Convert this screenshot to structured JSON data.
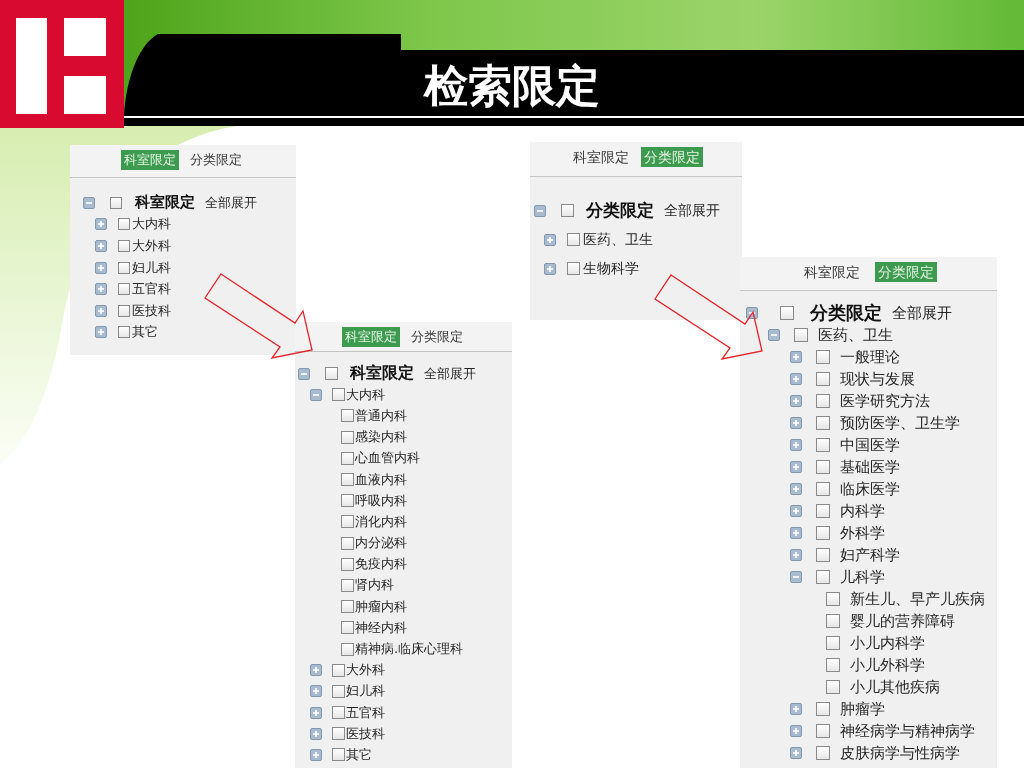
{
  "header": {
    "title": "检索限定"
  },
  "panels": [
    {
      "tabs": [
        {
          "label": "科室限定",
          "selected": true
        },
        {
          "label": "分类限定",
          "selected": false
        }
      ],
      "tree": {
        "label": "科室限定",
        "checked": false,
        "expanded": true,
        "action": "全部展开",
        "children": [
          {
            "label": "大内科",
            "checked": false,
            "expanded": false
          },
          {
            "label": "大外科",
            "checked": false,
            "expanded": false
          },
          {
            "label": "妇儿科",
            "checked": false,
            "expanded": false
          },
          {
            "label": "五官科",
            "checked": false,
            "expanded": false
          },
          {
            "label": "医技科",
            "checked": false,
            "expanded": false
          },
          {
            "label": "其它",
            "checked": false,
            "expanded": false
          }
        ]
      }
    },
    {
      "tabs": [
        {
          "label": "科室限定",
          "selected": true
        },
        {
          "label": "分类限定",
          "selected": false
        }
      ],
      "tree": {
        "label": "科室限定",
        "checked": false,
        "expanded": true,
        "action": "全部展开",
        "children": [
          {
            "label": "大内科",
            "checked": false,
            "expanded": true,
            "children": [
              {
                "label": "普通内科",
                "checked": false
              },
              {
                "label": "感染内科",
                "checked": false
              },
              {
                "label": "心血管内科",
                "checked": false
              },
              {
                "label": "血液内科",
                "checked": false
              },
              {
                "label": "呼吸内科",
                "checked": false
              },
              {
                "label": "消化内科",
                "checked": false
              },
              {
                "label": "内分泌科",
                "checked": false
              },
              {
                "label": "免疫内科",
                "checked": false
              },
              {
                "label": "肾内科",
                "checked": false
              },
              {
                "label": "肿瘤内科",
                "checked": false
              },
              {
                "label": "神经内科",
                "checked": false
              },
              {
                "label": "精神病.临床心理科",
                "checked": false
              }
            ]
          },
          {
            "label": "大外科",
            "checked": false,
            "expanded": false
          },
          {
            "label": "妇儿科",
            "checked": false,
            "expanded": false
          },
          {
            "label": "五官科",
            "checked": false,
            "expanded": false
          },
          {
            "label": "医技科",
            "checked": false,
            "expanded": false
          },
          {
            "label": "其它",
            "checked": false,
            "expanded": false
          }
        ]
      }
    },
    {
      "tabs": [
        {
          "label": "科室限定",
          "selected": false
        },
        {
          "label": "分类限定",
          "selected": true
        }
      ],
      "tree": {
        "label": "分类限定",
        "checked": false,
        "expanded": true,
        "action": "全部展开",
        "children": [
          {
            "label": "医药、卫生",
            "checked": false,
            "expanded": false
          },
          {
            "label": "生物科学",
            "checked": false,
            "expanded": false
          }
        ]
      }
    },
    {
      "tabs": [
        {
          "label": "科室限定",
          "selected": false
        },
        {
          "label": "分类限定",
          "selected": true
        }
      ],
      "tree": {
        "label": "分类限定",
        "checked": false,
        "expanded": true,
        "action": "全部展开",
        "children": [
          {
            "label": "医药、卫生",
            "checked": false,
            "expanded": true,
            "children": [
              {
                "label": "一般理论",
                "checked": false,
                "expanded": false
              },
              {
                "label": "现状与发展",
                "checked": false,
                "expanded": false
              },
              {
                "label": "医学研究方法",
                "checked": false,
                "expanded": false
              },
              {
                "label": "预防医学、卫生学",
                "checked": false,
                "expanded": false
              },
              {
                "label": "中国医学",
                "checked": false,
                "expanded": false
              },
              {
                "label": "基础医学",
                "checked": false,
                "expanded": false
              },
              {
                "label": "临床医学",
                "checked": false,
                "expanded": false
              },
              {
                "label": "内科学",
                "checked": false,
                "expanded": false
              },
              {
                "label": "外科学",
                "checked": false,
                "expanded": false
              },
              {
                "label": "妇产科学",
                "checked": false,
                "expanded": false
              },
              {
                "label": "儿科学",
                "checked": false,
                "expanded": true,
                "children": [
                  {
                    "label": "新生儿、早产儿疾病",
                    "checked": false
                  },
                  {
                    "label": "婴儿的营养障碍",
                    "checked": false
                  },
                  {
                    "label": "小儿内科学",
                    "checked": false
                  },
                  {
                    "label": "小儿外科学",
                    "checked": false
                  },
                  {
                    "label": "小儿其他疾病",
                    "checked": false
                  }
                ]
              },
              {
                "label": "肿瘤学",
                "checked": false,
                "expanded": false
              },
              {
                "label": "神经病学与精神病学",
                "checked": false,
                "expanded": false
              },
              {
                "label": "皮肤病学与性病学",
                "checked": false,
                "expanded": false
              }
            ]
          }
        ]
      }
    }
  ]
}
